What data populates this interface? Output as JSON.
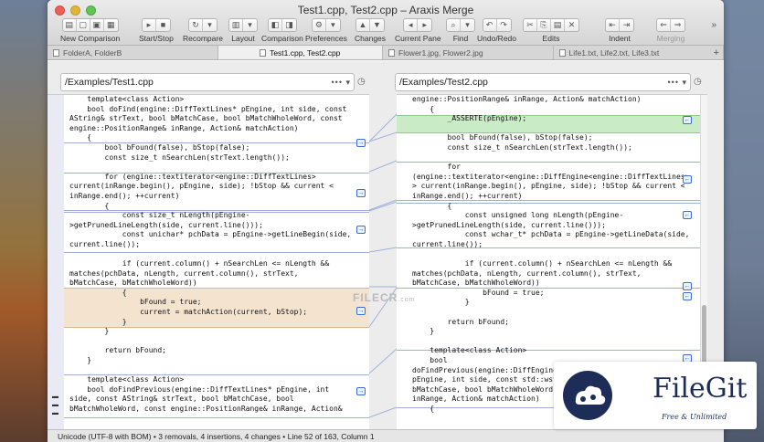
{
  "window": {
    "title": "Test1.cpp, Test2.cpp – Araxis Merge"
  },
  "toolbar": {
    "new_comparison": "New Comparison",
    "start_stop": "Start/Stop",
    "recompare": "Recompare",
    "layout": "Layout",
    "comparison": "Comparison",
    "preferences": "Preferences",
    "changes": "Changes",
    "current_pane": "Current Pane",
    "find": "Find",
    "undo_redo": "Undo/Redo",
    "edits": "Edits",
    "indent": "Indent",
    "merging": "Merging"
  },
  "tabs": [
    {
      "label": "FolderA, FolderB"
    },
    {
      "label": "Test1.cpp, Test2.cpp"
    },
    {
      "label": "Flower1.jpg, Flower2.jpg"
    },
    {
      "label": "Life1.txt, Life2.txt, Life3.txt"
    }
  ],
  "left_pane": {
    "path": "/Examples/Test1.cpp",
    "lines": [
      "    template<class Action>",
      "    bool doFind(engine::DiffTextLines* pEngine, int side, const",
      "AString& strText, bool bMatchCase, bool bMatchWholeWord, const",
      "engine::PositionRange& inRange, Action& matchAction)",
      "    {",
      "        bool bFound(false), bStop(false);",
      "        const size_t nSearchLen(strText.length());",
      "",
      "        for (engine::textiterator<engine::DiffTextLines>",
      "current(inRange.begin(), pEngine, side); !bStop && current <",
      "inRange.end(); ++current)",
      "        {",
      "            const size_t nLength(pEngine-",
      ">getPrunedLineLength(side, current.line()));",
      "            const unichar* pchData = pEngine->getLineBegin(side,",
      "current.line());",
      "",
      "            if (current.column() + nSearchLen <= nLength &&",
      "matches(pchData, nLength, current.column(), strText,",
      "bMatchCase, bMatchWholeWord))",
      "            {",
      "                bFound = true;",
      "                current = matchAction(current, bStop);",
      "            }",
      "        }",
      "",
      "        return bFound;",
      "    }",
      "",
      "    template<class Action>",
      "    bool doFindPrevious(engine::DiffTextLines* pEngine, int",
      "side, const AString& strText, bool bMatchCase, bool",
      "bMatchWholeWord, const engine::PositionRange& inRange, Action&"
    ]
  },
  "right_pane": {
    "path": "/Examples/Test2.cpp",
    "lines": [
      "engine::PositionRange& inRange, Action& matchAction)",
      "    {",
      "        _ASSERTE(pEngine);",
      "",
      "        bool bFound(false), bStop(false);",
      "        const size_t nSearchLen(strText.length());",
      "",
      "        for",
      "(engine::textiterator<engine::DiffEngine<engine::DiffTextLines>",
      "> current(inRange.begin(), pEngine, side); !bStop && current <",
      "inRange.end(); ++current)",
      "        {",
      "            const unsigned long nLength(pEngine-",
      ">getPrunedLineLength(side, current.line()));",
      "            const wchar_t* pchData = pEngine->getLineData(side,",
      "current.line());",
      "",
      "            if (current.column() + nSearchLen <= nLength &&",
      "matches(pchData, nLength, current.column(), strText,",
      "bMatchCase, bMatchWholeWord))",
      "                bFound = true;",
      "            }",
      "",
      "        return bFound;",
      "    }",
      "",
      "    template<class Action>",
      "    bool",
      "doFindPrevious(engine::DiffEngine",
      "pEngine, int side, const std::wst",
      "bMatchCase, bool bMatchWholeWord,",
      "inRange, Action& matchAction)",
      "    {"
    ]
  },
  "watermark": "FILECR",
  "watermark_sub": ".com",
  "status": "Unicode (UTF-8 with BOM) • 3 removals, 4 insertions, 4 changes • Line 52 of 163, Column 1",
  "logo": {
    "name": "FileGit",
    "tagline": "Free & Unlimited"
  }
}
